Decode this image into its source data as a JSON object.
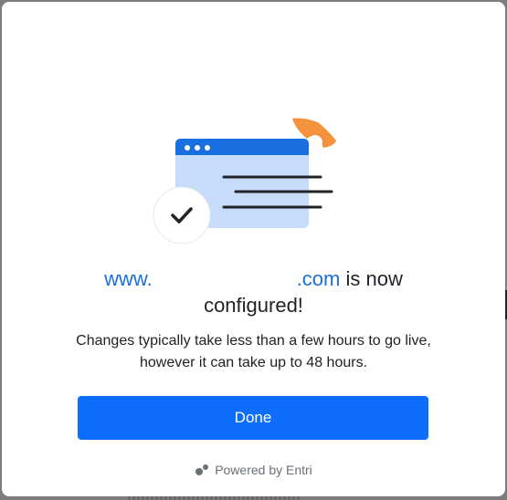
{
  "dialog": {
    "domain_prefix": "www.",
    "domain_suffix": ".com",
    "title_tail": " is now",
    "title_line2": "configured!",
    "subtitle": "Changes typically take less than a few hours to go live, however it can take up to 48 hours.",
    "done_label": "Done",
    "powered_by": "Powered by Entri"
  },
  "colors": {
    "accent": "#0d6efd",
    "link": "#1a6fe0",
    "browser_fill": "#c7dcfb",
    "browser_bar": "#1a6fe0",
    "orange": "#f5923e"
  },
  "icons": {
    "illustration": "browser-window-illustration",
    "check": "check-icon",
    "brand": "entri-logo-icon"
  }
}
